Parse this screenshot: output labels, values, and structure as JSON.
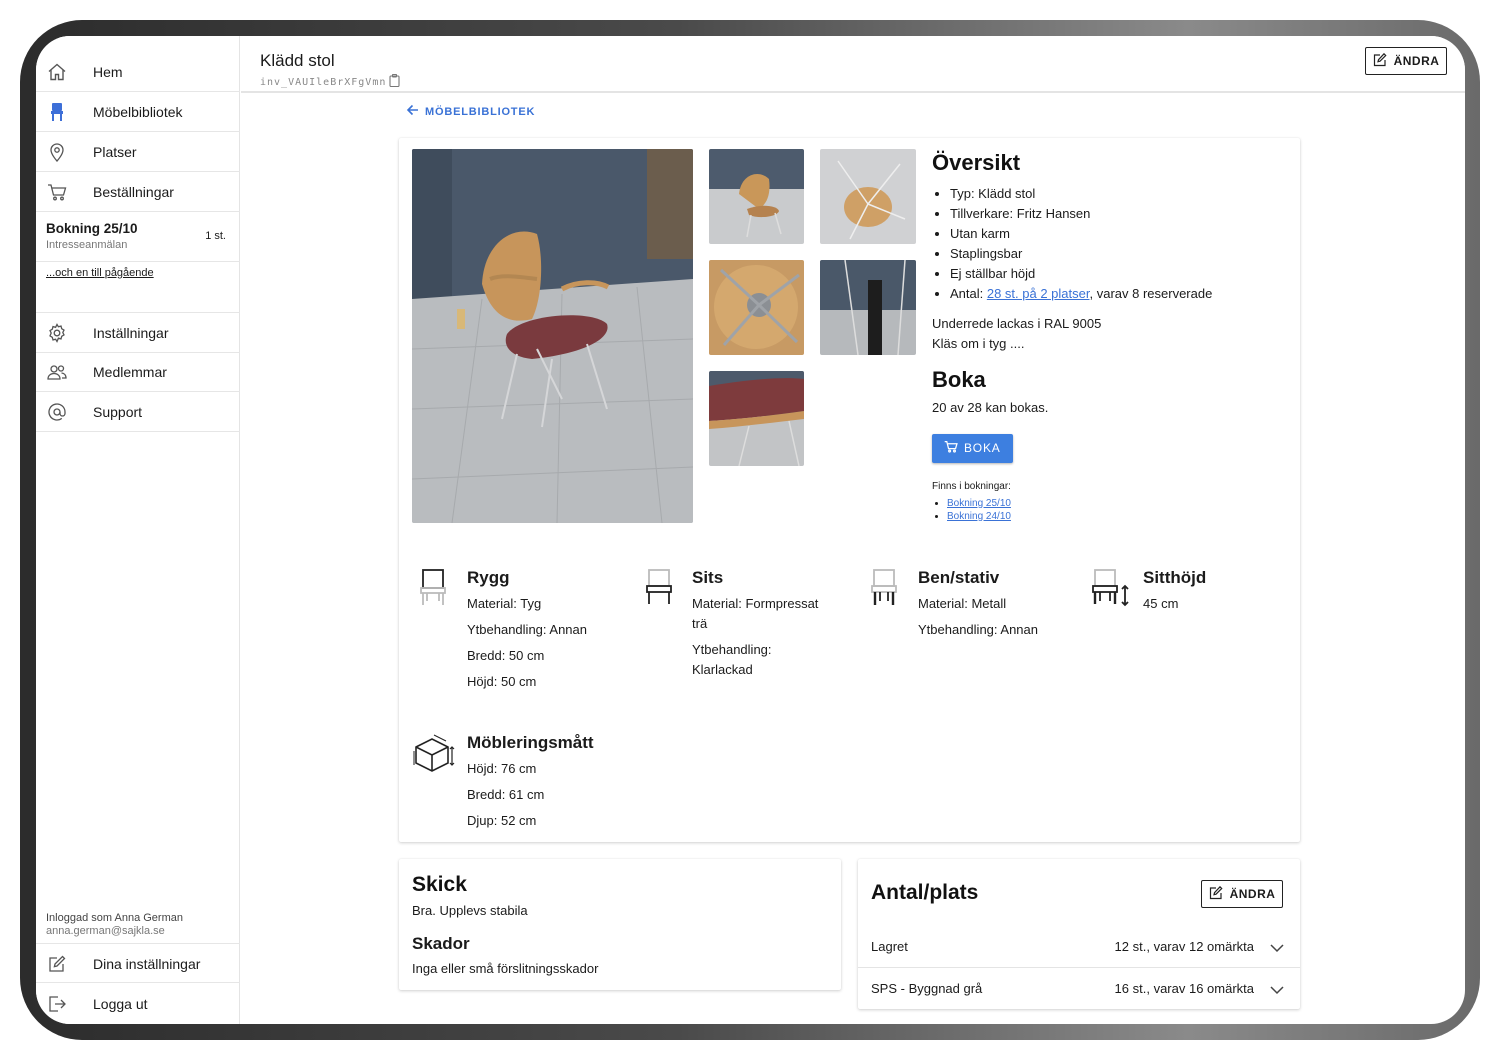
{
  "app": {
    "title": "Klädd stol",
    "id": "inv_VAUIleBrXFgVmn",
    "edit_label": "ÄNDRA"
  },
  "sidebar": {
    "items": [
      {
        "label": "Hem",
        "icon": "home-icon"
      },
      {
        "label": "Möbelbibliotek",
        "icon": "chair-icon"
      },
      {
        "label": "Platser",
        "icon": "location-pin-icon"
      },
      {
        "label": "Beställningar",
        "icon": "cart-icon"
      }
    ],
    "booking": {
      "title": "Bokning 25/10",
      "subtitle": "Intresseanmälan",
      "count": "1 st."
    },
    "more_link": "...och en till pågående",
    "items2": [
      {
        "label": "Inställningar",
        "icon": "gear-icon"
      },
      {
        "label": "Medlemmar",
        "icon": "members-icon"
      },
      {
        "label": "Support",
        "icon": "at-icon"
      }
    ],
    "logged_in": "Inloggad som Anna German",
    "email": "anna.german@sajkla.se",
    "bottom": [
      {
        "label": "Dina inställningar",
        "icon": "edit-icon"
      },
      {
        "label": "Logga ut",
        "icon": "logout-icon"
      }
    ]
  },
  "breadcrumb": {
    "back_label": "MÖBELBIBLIOTEK"
  },
  "overview": {
    "title": "Översikt",
    "bullets": {
      "typ": "Typ: Klädd stol",
      "tillverkare": "Tillverkare: Fritz Hansen",
      "karm": "Utan karm",
      "stapel": "Staplingsbar",
      "hojd": "Ej ställbar höjd",
      "antal_prefix": "Antal: ",
      "antal_link": "28 st. på 2 platser",
      "antal_suffix": ", varav 8 reserverade"
    },
    "note1": "Underrede lackas i RAL 9005",
    "note2": "Kläs om i tyg ...."
  },
  "boka": {
    "title": "Boka",
    "available": "20 av 28 kan bokas.",
    "button": "BOKA",
    "finns_label": "Finns i bokningar:",
    "bookings": [
      "Bokning 25/10",
      "Bokning 24/10"
    ]
  },
  "specs": {
    "rygg": {
      "title": "Rygg",
      "lines": [
        "Material: Tyg",
        "Ytbehandling: Annan",
        "Bredd: 50 cm",
        "Höjd: 50 cm"
      ]
    },
    "sits": {
      "title": "Sits",
      "lines": [
        "Material: Formpressat trä",
        "Ytbehandling: Klarlackad"
      ]
    },
    "ben": {
      "title": "Ben/stativ",
      "lines": [
        "Material: Metall",
        "Ytbehandling: Annan"
      ]
    },
    "sitthojd": {
      "title": "Sitthöjd",
      "lines": [
        "45 cm"
      ]
    },
    "matt": {
      "title": "Möbleringsmått",
      "lines": [
        "Höjd: 76 cm",
        "Bredd: 61 cm",
        "Djup: 52 cm"
      ]
    }
  },
  "skick": {
    "title": "Skick",
    "text": "Bra. Upplevs stabila",
    "skador_title": "Skador",
    "skador_text": "Inga eller små förslitningsskador"
  },
  "antal": {
    "title": "Antal/plats",
    "edit_label": "ÄNDRA",
    "rows": [
      {
        "label": "Lagret",
        "value": "12 st., varav 12 omärkta"
      },
      {
        "label": "SPS - Byggnad grå",
        "value": "16 st., varav 16 omärkta"
      }
    ]
  }
}
